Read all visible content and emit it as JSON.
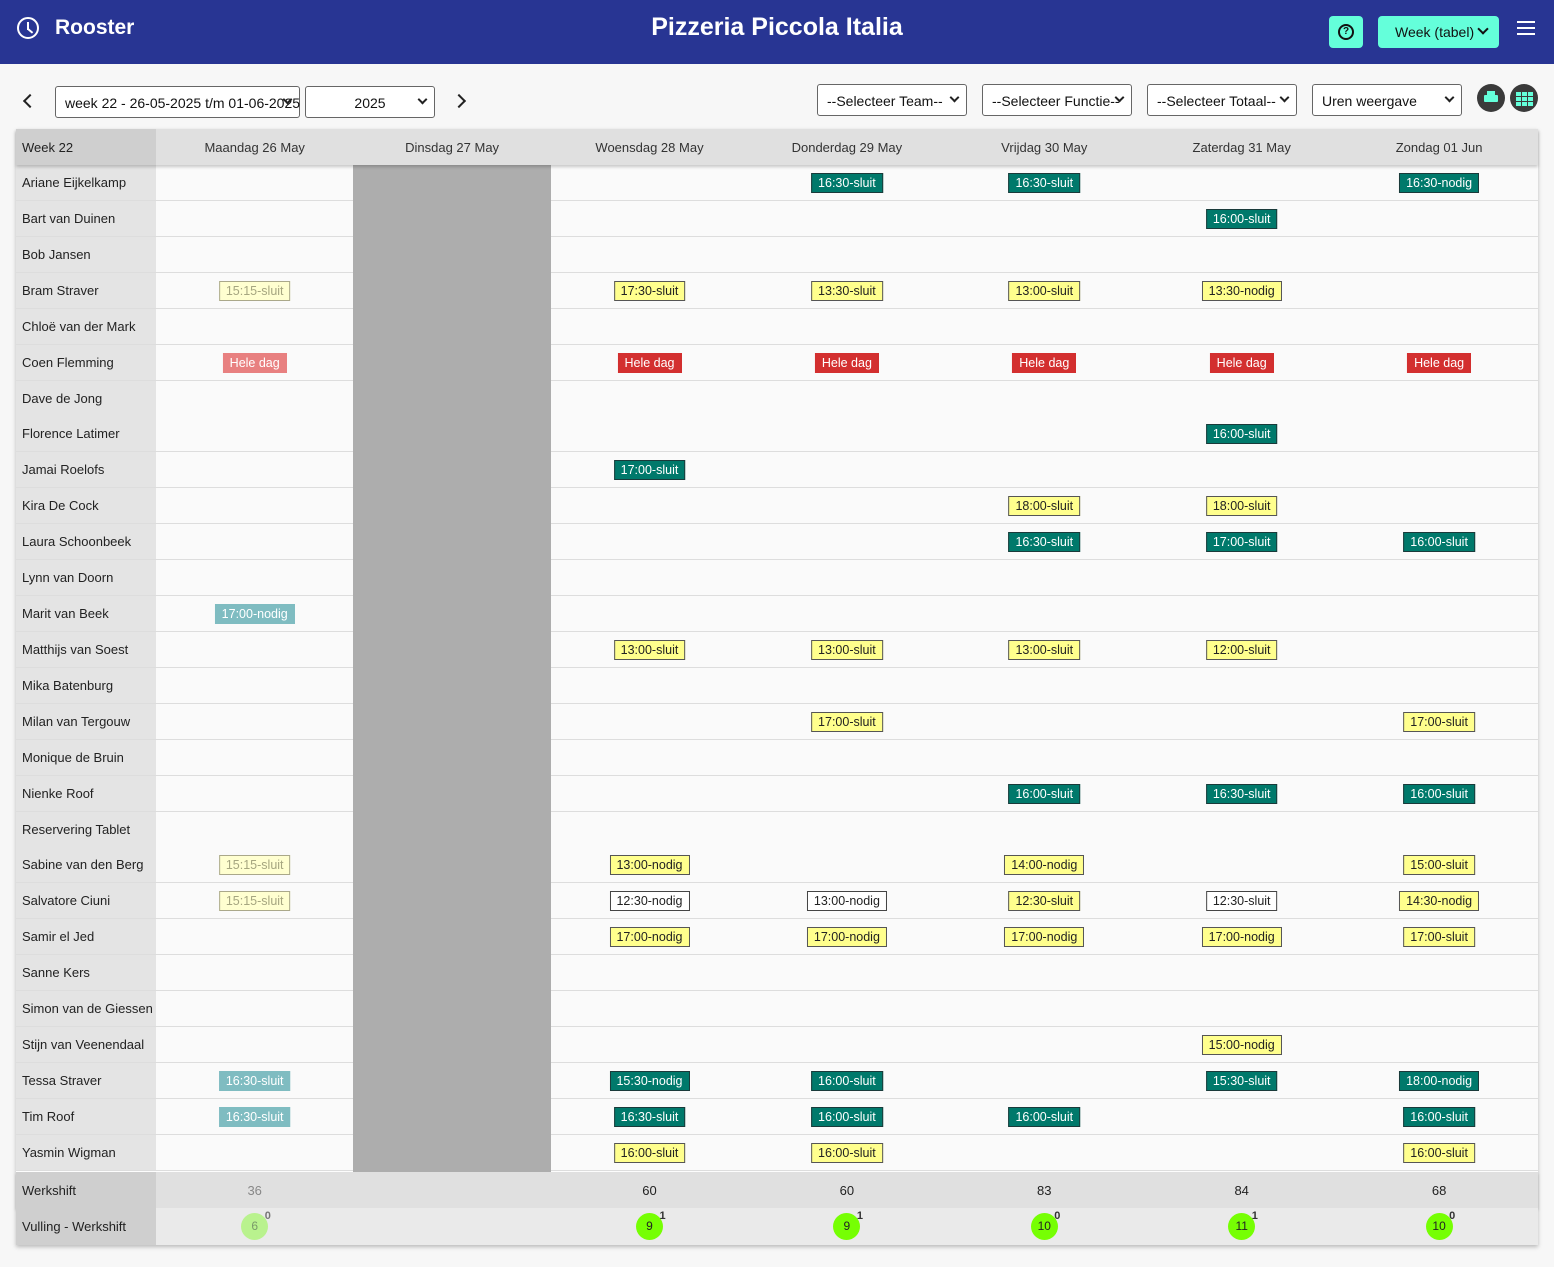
{
  "header": {
    "app_title": "Rooster",
    "venue": "Pizzeria Piccola Italia",
    "view_select": "Week (tabel)"
  },
  "toolbar": {
    "week_select": "week 22 - 26-05-2025 t/m 01-06-2025",
    "year_select": "2025",
    "team_select": "--Selecteer Team--",
    "function_select": "--Selecteer Functie--",
    "total_select": "--Selecteer Totaal--",
    "display_select": "Uren weergave"
  },
  "table": {
    "week_label": "Week 22",
    "days": [
      "Maandag 26 May",
      "Dinsdag 27 May",
      "Woensdag 28 May",
      "Donderdag 29 May",
      "Vrijdag 30 May",
      "Zaterdag 31 May",
      "Zondag 01 Jun"
    ],
    "closed_day_index": 1,
    "employees": [
      {
        "name": "Ariane Eijkelkamp",
        "shifts": [
          null,
          null,
          null,
          {
            "text": "16:30-sluit",
            "style": "teal"
          },
          {
            "text": "16:30-sluit",
            "style": "teal"
          },
          null,
          {
            "text": "16:30-nodig",
            "style": "teal"
          }
        ]
      },
      {
        "name": "Bart van Duinen",
        "shifts": [
          null,
          null,
          null,
          null,
          null,
          {
            "text": "16:00-sluit",
            "style": "teal"
          },
          null
        ]
      },
      {
        "name": "Bob Jansen",
        "shifts": [
          null,
          null,
          null,
          null,
          null,
          null,
          null
        ]
      },
      {
        "name": "Bram Straver",
        "shifts": [
          {
            "text": "15:15-sluit",
            "style": "yellow-faded"
          },
          null,
          {
            "text": "17:30-sluit",
            "style": "yellow"
          },
          {
            "text": "13:30-sluit",
            "style": "yellow"
          },
          {
            "text": "13:00-sluit",
            "style": "yellow"
          },
          {
            "text": "13:30-nodig",
            "style": "yellow"
          },
          null
        ]
      },
      {
        "name": "Chloë van der Mark",
        "shifts": [
          null,
          null,
          null,
          null,
          null,
          null,
          null
        ]
      },
      {
        "name": "Coen Flemming",
        "shifts": [
          {
            "text": "Hele dag",
            "style": "red-faded"
          },
          null,
          {
            "text": "Hele dag",
            "style": "red"
          },
          {
            "text": "Hele dag",
            "style": "red"
          },
          {
            "text": "Hele dag",
            "style": "red"
          },
          {
            "text": "Hele dag",
            "style": "red"
          },
          {
            "text": "Hele dag",
            "style": "red"
          }
        ]
      },
      {
        "name": "Dave de Jong",
        "shifts": [
          null,
          null,
          null,
          null,
          null,
          null,
          null
        ]
      },
      {
        "name": "Florence Latimer",
        "shifts": [
          null,
          null,
          null,
          null,
          null,
          {
            "text": "16:00-sluit",
            "style": "teal"
          },
          null
        ]
      },
      {
        "name": "Jamai Roelofs",
        "shifts": [
          null,
          null,
          {
            "text": "17:00-sluit",
            "style": "teal"
          },
          null,
          null,
          null,
          null
        ]
      },
      {
        "name": "Kira De Cock",
        "shifts": [
          null,
          null,
          null,
          null,
          {
            "text": "18:00-sluit",
            "style": "yellow"
          },
          {
            "text": "18:00-sluit",
            "style": "yellow"
          },
          null
        ]
      },
      {
        "name": "Laura Schoonbeek",
        "shifts": [
          null,
          null,
          null,
          null,
          {
            "text": "16:30-sluit",
            "style": "teal"
          },
          {
            "text": "17:00-sluit",
            "style": "teal"
          },
          {
            "text": "16:00-sluit",
            "style": "teal"
          }
        ]
      },
      {
        "name": "Lynn van Doorn",
        "shifts": [
          null,
          null,
          null,
          null,
          null,
          null,
          null
        ]
      },
      {
        "name": "Marit van Beek",
        "shifts": [
          {
            "text": "17:00-nodig",
            "style": "teal-faded"
          },
          null,
          null,
          null,
          null,
          null,
          null
        ]
      },
      {
        "name": "Matthijs van Soest",
        "shifts": [
          null,
          null,
          {
            "text": "13:00-sluit",
            "style": "yellow"
          },
          {
            "text": "13:00-sluit",
            "style": "yellow"
          },
          {
            "text": "13:00-sluit",
            "style": "yellow"
          },
          {
            "text": "12:00-sluit",
            "style": "yellow"
          },
          null
        ]
      },
      {
        "name": "Mika Batenburg",
        "shifts": [
          null,
          null,
          null,
          null,
          null,
          null,
          null
        ]
      },
      {
        "name": "Milan van Tergouw",
        "shifts": [
          null,
          null,
          null,
          {
            "text": "17:00-sluit",
            "style": "yellow"
          },
          null,
          null,
          {
            "text": "17:00-sluit",
            "style": "yellow"
          }
        ]
      },
      {
        "name": "Monique de Bruin",
        "shifts": [
          null,
          null,
          null,
          null,
          null,
          null,
          null
        ]
      },
      {
        "name": "Nienke Roof",
        "shifts": [
          null,
          null,
          null,
          null,
          {
            "text": "16:00-sluit",
            "style": "teal"
          },
          {
            "text": "16:30-sluit",
            "style": "teal"
          },
          {
            "text": "16:00-sluit",
            "style": "teal"
          }
        ]
      },
      {
        "name": "Reservering Tablet",
        "shifts": [
          null,
          null,
          null,
          null,
          null,
          null,
          null
        ]
      },
      {
        "name": "Sabine van den Berg",
        "shifts": [
          {
            "text": "15:15-sluit",
            "style": "yellow-faded"
          },
          null,
          {
            "text": "13:00-nodig",
            "style": "yellow"
          },
          null,
          {
            "text": "14:00-nodig",
            "style": "yellow"
          },
          null,
          {
            "text": "15:00-sluit",
            "style": "yellow"
          }
        ]
      },
      {
        "name": "Salvatore Ciuni",
        "shifts": [
          {
            "text": "15:15-sluit",
            "style": "yellow-faded"
          },
          null,
          {
            "text": "12:30-nodig",
            "style": "white"
          },
          {
            "text": "13:00-nodig",
            "style": "white"
          },
          {
            "text": "12:30-sluit",
            "style": "yellow"
          },
          {
            "text": "12:30-sluit",
            "style": "white"
          },
          {
            "text": "14:30-nodig",
            "style": "yellow"
          }
        ]
      },
      {
        "name": "Samir el Jed",
        "shifts": [
          null,
          null,
          {
            "text": "17:00-nodig",
            "style": "yellow"
          },
          {
            "text": "17:00-nodig",
            "style": "yellow"
          },
          {
            "text": "17:00-nodig",
            "style": "yellow"
          },
          {
            "text": "17:00-nodig",
            "style": "yellow"
          },
          {
            "text": "17:00-sluit",
            "style": "yellow"
          }
        ]
      },
      {
        "name": "Sanne Kers",
        "shifts": [
          null,
          null,
          null,
          null,
          null,
          null,
          null
        ]
      },
      {
        "name": "Simon van de Giessen",
        "shifts": [
          null,
          null,
          null,
          null,
          null,
          null,
          null
        ]
      },
      {
        "name": "Stijn van Veenendaal",
        "shifts": [
          null,
          null,
          null,
          null,
          null,
          {
            "text": "15:00-nodig",
            "style": "yellow"
          },
          null
        ]
      },
      {
        "name": "Tessa Straver",
        "shifts": [
          {
            "text": "16:30-sluit",
            "style": "teal-faded"
          },
          null,
          {
            "text": "15:30-nodig",
            "style": "teal"
          },
          {
            "text": "16:00-sluit",
            "style": "teal"
          },
          null,
          {
            "text": "15:30-sluit",
            "style": "teal"
          },
          {
            "text": "18:00-nodig",
            "style": "teal"
          }
        ]
      },
      {
        "name": "Tim Roof",
        "shifts": [
          {
            "text": "16:30-sluit",
            "style": "teal-faded"
          },
          null,
          {
            "text": "16:30-sluit",
            "style": "teal"
          },
          {
            "text": "16:00-sluit",
            "style": "teal"
          },
          {
            "text": "16:00-sluit",
            "style": "teal"
          },
          null,
          {
            "text": "16:00-sluit",
            "style": "teal"
          }
        ]
      },
      {
        "name": "Yasmin Wigman",
        "shifts": [
          null,
          null,
          {
            "text": "16:00-sluit",
            "style": "yellow"
          },
          {
            "text": "16:00-sluit",
            "style": "yellow"
          },
          null,
          null,
          {
            "text": "16:00-sluit",
            "style": "yellow"
          }
        ]
      }
    ],
    "summary_label": "Werkshift",
    "summary": [
      "36",
      "",
      "60",
      "60",
      "83",
      "84",
      "68"
    ],
    "fill_label": "Vulling - Werkshift",
    "fill": [
      {
        "value": "6",
        "sup": "0",
        "faded": true
      },
      null,
      {
        "value": "9",
        "sup": "1"
      },
      {
        "value": "9",
        "sup": "1"
      },
      {
        "value": "10",
        "sup": "0"
      },
      {
        "value": "11",
        "sup": "1"
      },
      {
        "value": "10",
        "sup": "0"
      }
    ]
  },
  "icons": {
    "clock": "clock-icon",
    "help": "help-circle-icon",
    "menu": "hamburger-menu-icon",
    "prev": "chevron-left-icon",
    "next": "chevron-right-icon",
    "print": "printer-icon",
    "grid": "grid-icon"
  },
  "colors": {
    "header_bg": "#283593",
    "accent": "#64ffda",
    "shift_teal": "#00796b",
    "shift_yellow": "#ffff8d",
    "absence_red": "#d32f2f",
    "fill_green": "#76ff03"
  }
}
